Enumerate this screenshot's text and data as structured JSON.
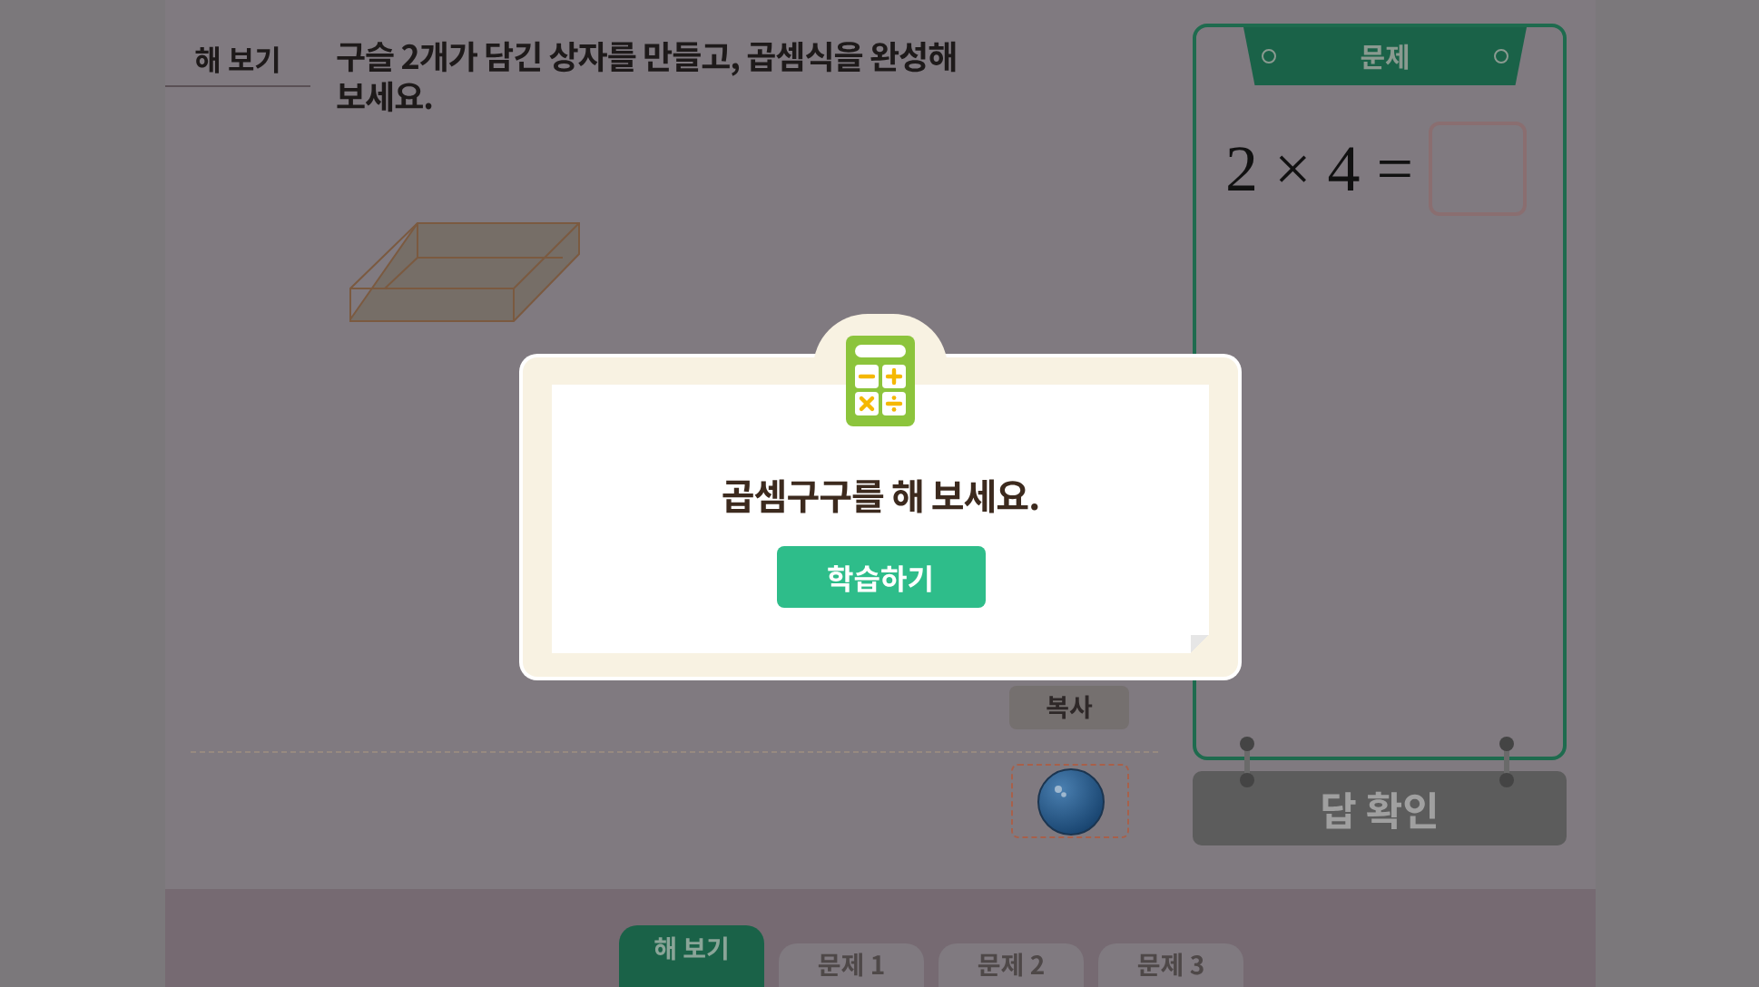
{
  "header": {
    "label": "해 보기",
    "question": "구슬 2개가 담긴 상자를 만들고, 곱셈식을 완성해 보세요."
  },
  "copy_button": "복사",
  "problem": {
    "title": "문제",
    "equation": "2 × 4 ="
  },
  "check_button": {
    "label": "답 확인",
    "disabled": true
  },
  "dialog": {
    "message": "곱셈구구를 해 보세요.",
    "button": "학습하기"
  },
  "tabs": [
    {
      "label": "해 보기",
      "selected": true
    },
    {
      "label": "문제 1",
      "selected": false
    },
    {
      "label": "문제 2",
      "selected": false
    },
    {
      "label": "문제 3",
      "selected": false
    }
  ]
}
